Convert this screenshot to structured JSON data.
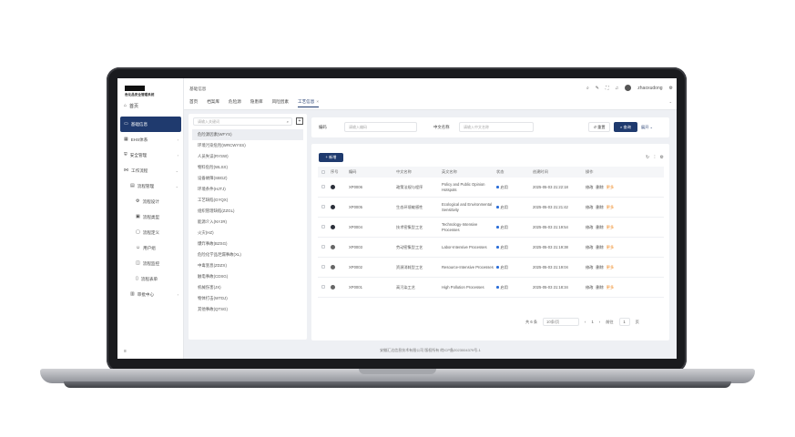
{
  "app": {
    "logo_text": "危化品安全管理系统",
    "home": "首页"
  },
  "sidebar": {
    "items": [
      {
        "label": "基础信息",
        "icon": "folder-icon",
        "active": true
      },
      {
        "label": "EHS体系",
        "icon": "grid-icon",
        "chev": "›"
      },
      {
        "label": "安全管理",
        "icon": "shield-icon",
        "chev": "›"
      },
      {
        "label": "工作流程",
        "icon": "flow-icon",
        "chev": "⌄"
      },
      {
        "label": "流程管理",
        "icon": "list-icon",
        "chev": "⌄",
        "level": 1
      },
      {
        "label": "流程设计",
        "icon": "design-icon",
        "level": 2
      },
      {
        "label": "流程类型",
        "icon": "type-icon",
        "level": 2
      },
      {
        "label": "流程定义",
        "icon": "define-icon",
        "level": 2
      },
      {
        "label": "用户组",
        "icon": "users-icon",
        "level": 2
      },
      {
        "label": "流程监控",
        "icon": "monitor-icon",
        "level": 2
      },
      {
        "label": "流程表单",
        "icon": "form-icon",
        "level": 2
      },
      {
        "label": "审批中心",
        "icon": "approve-icon",
        "chev": "›",
        "level": 1
      }
    ],
    "collapse": "≡"
  },
  "topbar": {
    "breadcrumb": "基础信息",
    "username": "zhaoxudong",
    "tabs": [
      "首页",
      "档案库",
      "危险源",
      "隐患库",
      "风险因素",
      "工艺信息"
    ],
    "active_tab_index": 5,
    "tab_close": "×"
  },
  "tree": {
    "placeholder": "请输入关键词",
    "items": [
      "危险源因素(WFYS)",
      "环境污染危险(WRCWYSS)",
      "人员失误(RYSW)",
      "物料危险(WLSX)",
      "设备故障(SBGZ)",
      "环境条件(HJTJ)",
      "工艺缺陷(GYQX)",
      "组织管理缺陷(ZZGL)",
      "能源介入(NYJR)",
      "火灾(HZ)",
      "爆炸事故(BZSG)",
      "危险化学品泄漏事故(XL)",
      "中毒窒息(ZDZX)",
      "触电事故(CDSG)",
      "机械伤害(JX)",
      "物体打击(WTDJ)",
      "其他事故(QTSG)"
    ],
    "selected_index": 0
  },
  "filter": {
    "code_label": "编码",
    "code_placeholder": "请输入编码",
    "name_label": "中文名称",
    "name_placeholder": "请输入中文名称",
    "reset": "↺ 重置",
    "search": "⌕ 查询",
    "expand": "展开 ⌄"
  },
  "table": {
    "add_label": "+ 新增",
    "headers": [
      "",
      "序号",
      "编码",
      "中文名称",
      "英文名称",
      "状态",
      "创建时间",
      "操作"
    ],
    "rows": [
      {
        "index": "1",
        "code": "XP0006",
        "name_cn": "政策法规与程序",
        "name_en": "Policy and Public Opinion Hotspots",
        "status": "启用",
        "time": "2025-05-03 21:22:18",
        "dot": "#2b2f3a"
      },
      {
        "index": "2",
        "code": "XP0005",
        "name_cn": "生态环境敏感性",
        "name_en": "Ecological and Environmental Sensitivity",
        "status": "启用",
        "time": "2025-05-03 21:21:42",
        "dot": "#2b2f3a"
      },
      {
        "index": "3",
        "code": "XP0004",
        "name_cn": "技术密集型工艺",
        "name_en": "Technology-Intensive Processes",
        "status": "启用",
        "time": "2025-05-03 21:19:54",
        "dot": "#2b2f3a"
      },
      {
        "index": "4",
        "code": "XP0003",
        "name_cn": "劳动密集型工艺",
        "name_en": "Labor-Intensive Processes",
        "status": "启用",
        "time": "2025-05-03 21:19:38",
        "dot": "#666"
      },
      {
        "index": "5",
        "code": "XP0002",
        "name_cn": "资源消耗型工艺",
        "name_en": "Resource-Intensive Processes",
        "status": "启用",
        "time": "2025-05-03 21:19:04",
        "dot": "#666"
      },
      {
        "index": "6",
        "code": "XP0001",
        "name_cn": "高污染工艺",
        "name_en": "High Pollution Processes",
        "status": "启用",
        "time": "2025-05-03 21:18:34",
        "dot": "#666"
      }
    ],
    "actions": [
      "修改",
      "删除",
      "更多"
    ],
    "pager": {
      "total": "共 6 条",
      "page_size": "10条/页",
      "prev": "‹",
      "current": "1",
      "next": "›",
      "goto": "前往",
      "goto_value": "1",
      "page_unit": "页"
    }
  },
  "footer": "安徽汇达信息技术有限公司 版权所有 皖ICP备2023004379号-1",
  "colors": {
    "primary": "#1f3a6e",
    "accent": "#f08a24",
    "status": "#2a6dd8"
  }
}
